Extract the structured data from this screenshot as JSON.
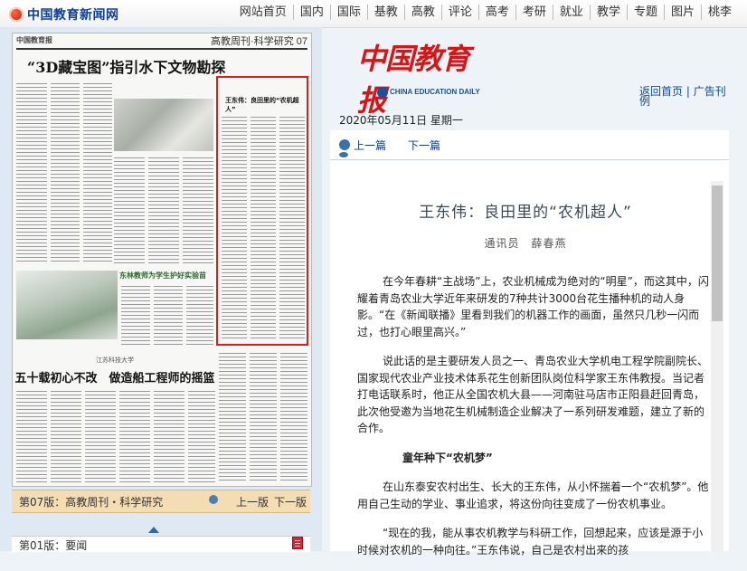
{
  "site": {
    "logo_text": "中国教育新闻网"
  },
  "topnav": [
    "网站首页",
    "国内",
    "国际",
    "基教",
    "高教",
    "评论",
    "高考",
    "考研",
    "就业",
    "教学",
    "专题",
    "图片",
    "桃李"
  ],
  "paper_preview": {
    "masthead": "中国教育报",
    "edition": "高教周刊·科学研究 07",
    "headline": "“3D藏宝图”指引水下文物勘探",
    "headline2_kicker": "江苏科技大学",
    "headline2": "五十载初心不改　做造船工程师的摇篮",
    "subhead": "东林教师为学生护好实验苗",
    "highlight_title": "王东伟：良田里的“农机超人”"
  },
  "edition_bar": {
    "current": "第07版：高教周刊・科学研究",
    "prev": "上一版",
    "next": "下一版"
  },
  "edition_list": [
    {
      "label": "第01版：要闻"
    }
  ],
  "masthead": {
    "cn": "中国教育报",
    "en": "CHINA EDUCATION DAILY"
  },
  "back_links": {
    "home": "返回首页",
    "ad": "广告刊",
    "ad_wrap": "例"
  },
  "date": "2020年05月11日  星期一",
  "article_nav": {
    "prev": "上一篇",
    "next": "下一篇"
  },
  "article": {
    "title": "王东伟：良田里的“农机超人”",
    "byline": "通讯员　薛春燕",
    "paragraphs": [
      "在今年春耕“主战场”上，农业机械成为绝对的“明星”，而这其中，闪耀着青岛农业大学近年来研发的7种共计3000台花生播种机的动人身影。“在《新闻联播》里看到我们的机器工作的画面，虽然只几秒一闪而过，也打心眼里高兴。”",
      "说此话的是主要研发人员之一、青岛农业大学机电工程学院副院长、国家现代农业产业技术体系花生创新团队岗位科学家王东伟教授。当记者打电话联系时，他正从全国农机大县——河南驻马店市正阳县赶回青岛，此次他受邀为当地花生机械制造企业解决了一系列研发难题，建立了新的合作。",
      "在山东泰安农村出生、长大的王东伟，从小怀揣着一个“农机梦”。他用自己生动的学业、事业追求，将这份向往变成了一份农机事业。",
      "“现在的我，能从事农机教学与科研工作，回想起来，应该是源于小时候对农机的一种向往。”王东伟说，自己是农村出来的孩"
    ],
    "subheading": "童年种下“农机梦”"
  },
  "colors": {
    "accent_red": "#d81414",
    "link_blue": "#0b4aa0",
    "edition_bar_bg": "#f4ddb2"
  }
}
